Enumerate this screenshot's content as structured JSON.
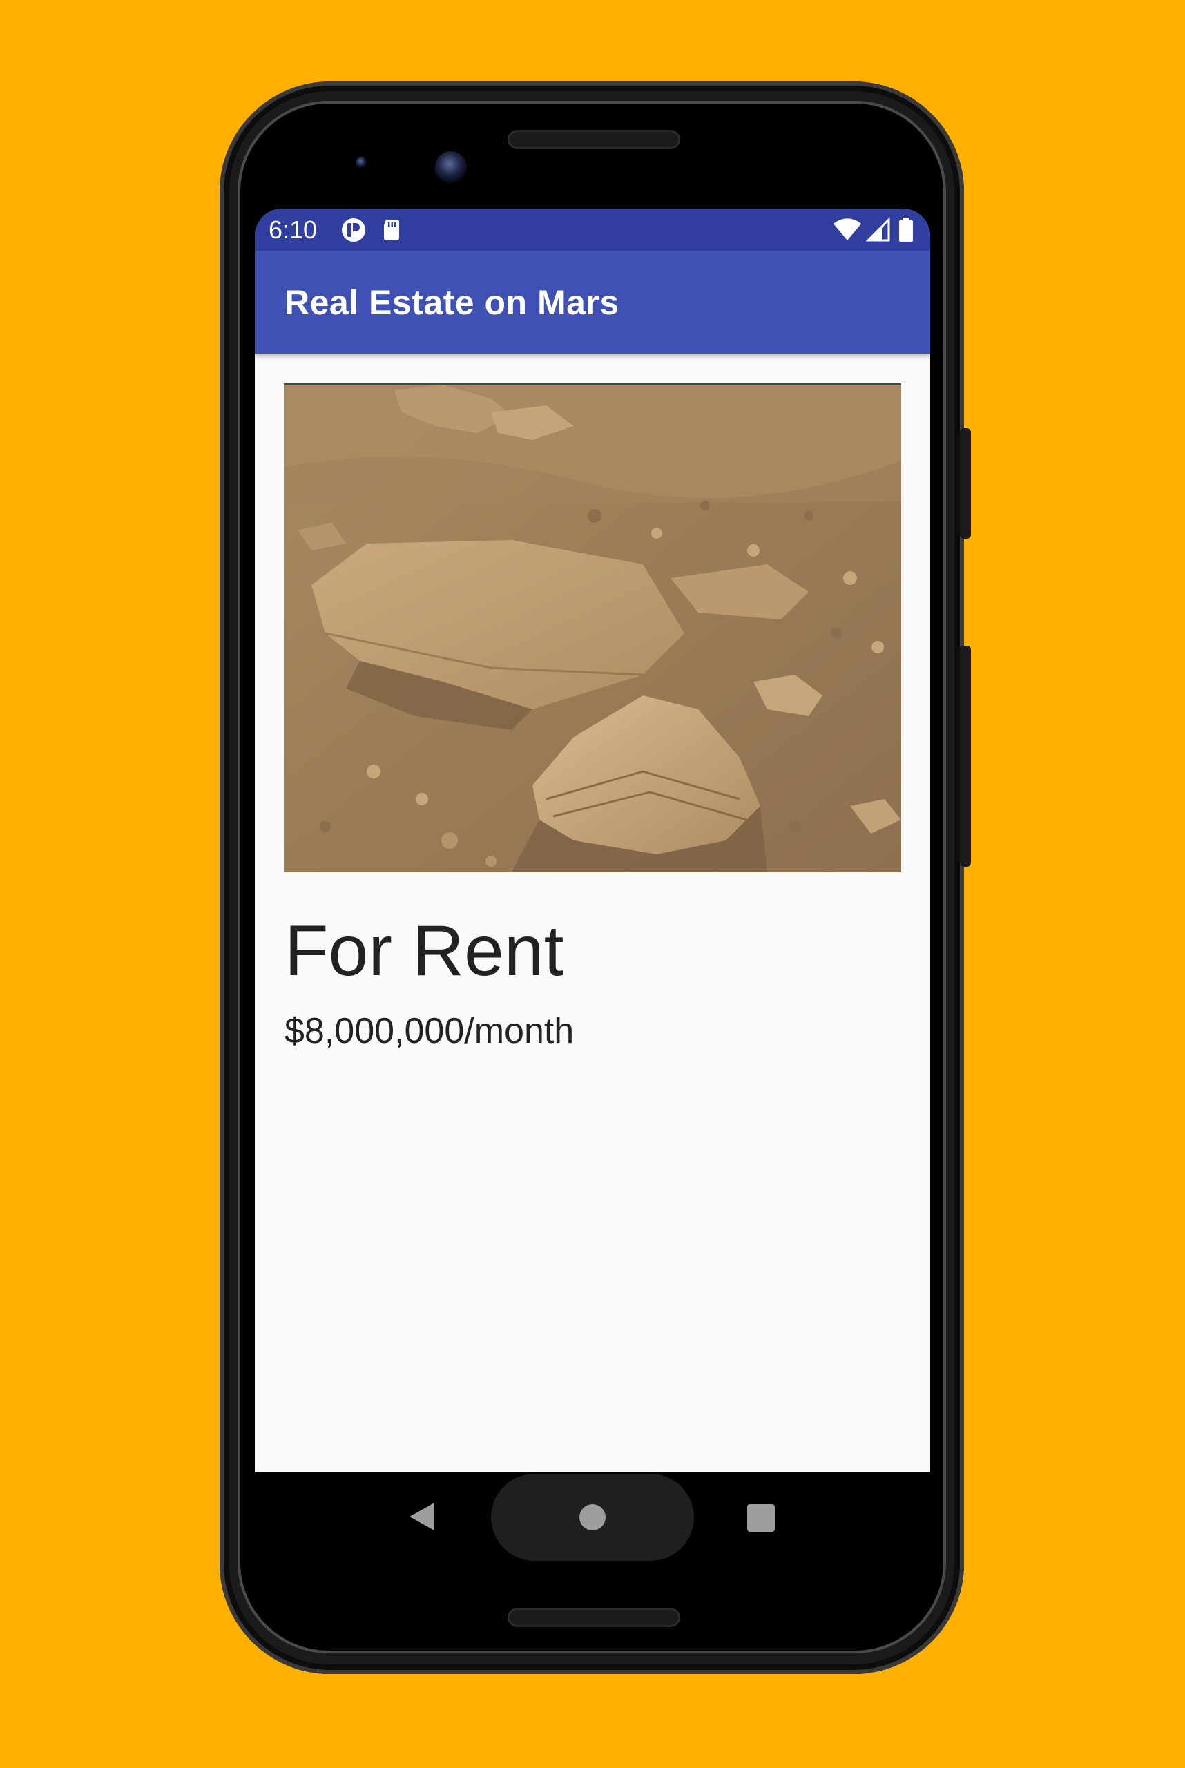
{
  "status_bar": {
    "time": "6:10",
    "left_icons": [
      "app-notification-icon",
      "sd-card-icon"
    ],
    "right_icons": [
      "wifi-icon",
      "signal-icon",
      "battery-icon"
    ]
  },
  "app_bar": {
    "title": "Real Estate on Mars"
  },
  "listing": {
    "image_icon": "mars-surface-photo",
    "type": "For Rent",
    "price": "$8,000,000/month"
  },
  "nav_bar": {
    "icons": [
      "back-icon",
      "home-icon",
      "recents-icon"
    ]
  },
  "colors": {
    "background": "#FFB000",
    "status_bar": "#303F9F",
    "app_bar": "#3F51B5",
    "screen": "#FAFAFA",
    "text": "#222222"
  }
}
